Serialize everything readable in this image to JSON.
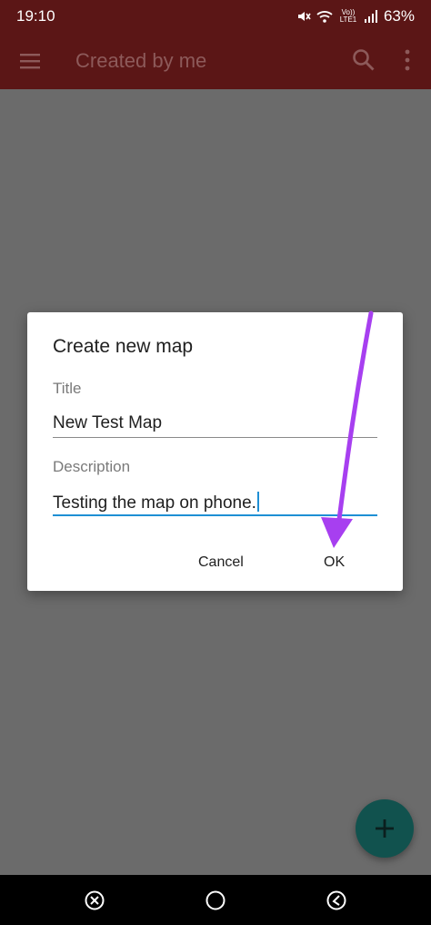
{
  "status_bar": {
    "time": "19:10",
    "network_label": "Vo)) LTE1",
    "battery": "63%"
  },
  "app_bar": {
    "title": "Created by me"
  },
  "dialog": {
    "title": "Create new map",
    "title_field": {
      "label": "Title",
      "value": "New Test Map"
    },
    "description_field": {
      "label": "Description",
      "value": "Testing the map on phone."
    },
    "cancel_label": "Cancel",
    "ok_label": "OK"
  },
  "fab": {
    "icon": "plus-icon"
  },
  "nav_bar": {
    "icons": [
      "recents-icon",
      "home-icon",
      "back-icon"
    ]
  },
  "colors": {
    "app_bar": "#5b1616",
    "scrim": "#6b6b6b",
    "fab": "#11524e",
    "focus_underline": "#1e8fd4",
    "annotation_arrow": "#a73ff0"
  }
}
